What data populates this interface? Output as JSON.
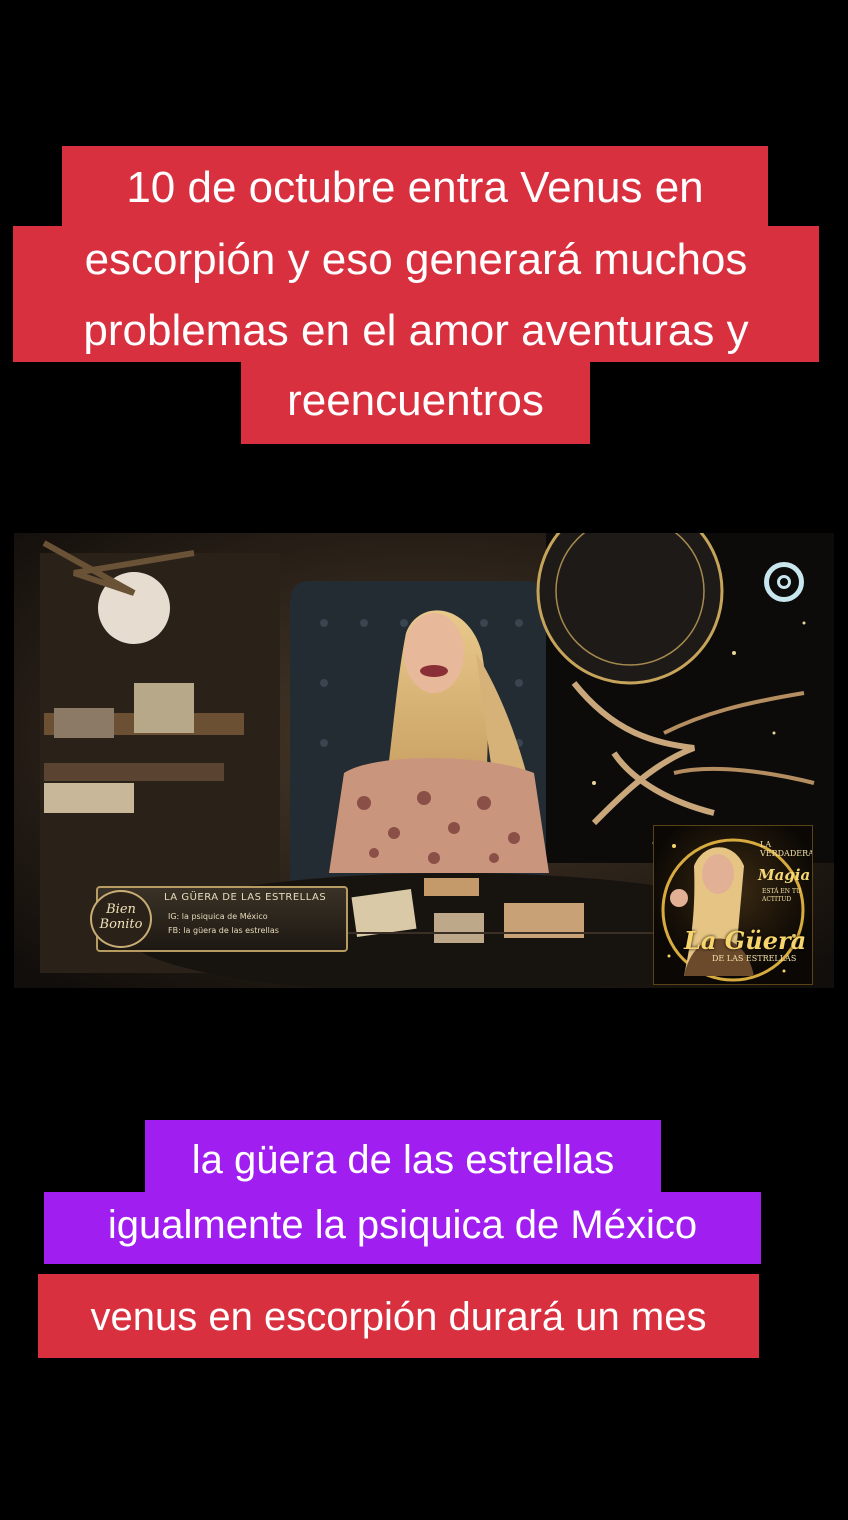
{
  "top_caption": {
    "lines": [
      "10 de octubre entra Venus en",
      "escorpión y eso generará muchos",
      "problemas en el amor aventuras y",
      "reencuentros"
    ],
    "background": "#d9303f"
  },
  "video": {
    "show_plate": {
      "logo_text": "Bien Bonito",
      "title": "LA GÜERA DE LAS ESTRELLAS",
      "line1": "IG: la psiquica de México",
      "line2": "FB: la güera de las estrellas"
    },
    "promo": {
      "top": "LA VERDADERA",
      "magic": "Magia",
      "tagline": "ESTÁ EN TU ACTITUD",
      "name": "La Güera",
      "subname": "DE LAS ESTRELLAS"
    },
    "channel_logo_icon": "channel-logo-icon"
  },
  "bottom_captions": [
    {
      "text": "la güera de las estrellas",
      "background": "#a01ff0"
    },
    {
      "text": "igualmente la psiquica de México",
      "background": "#a01ff0"
    },
    {
      "text": "venus en escorpión durará un mes",
      "background": "#d9303f"
    }
  ]
}
